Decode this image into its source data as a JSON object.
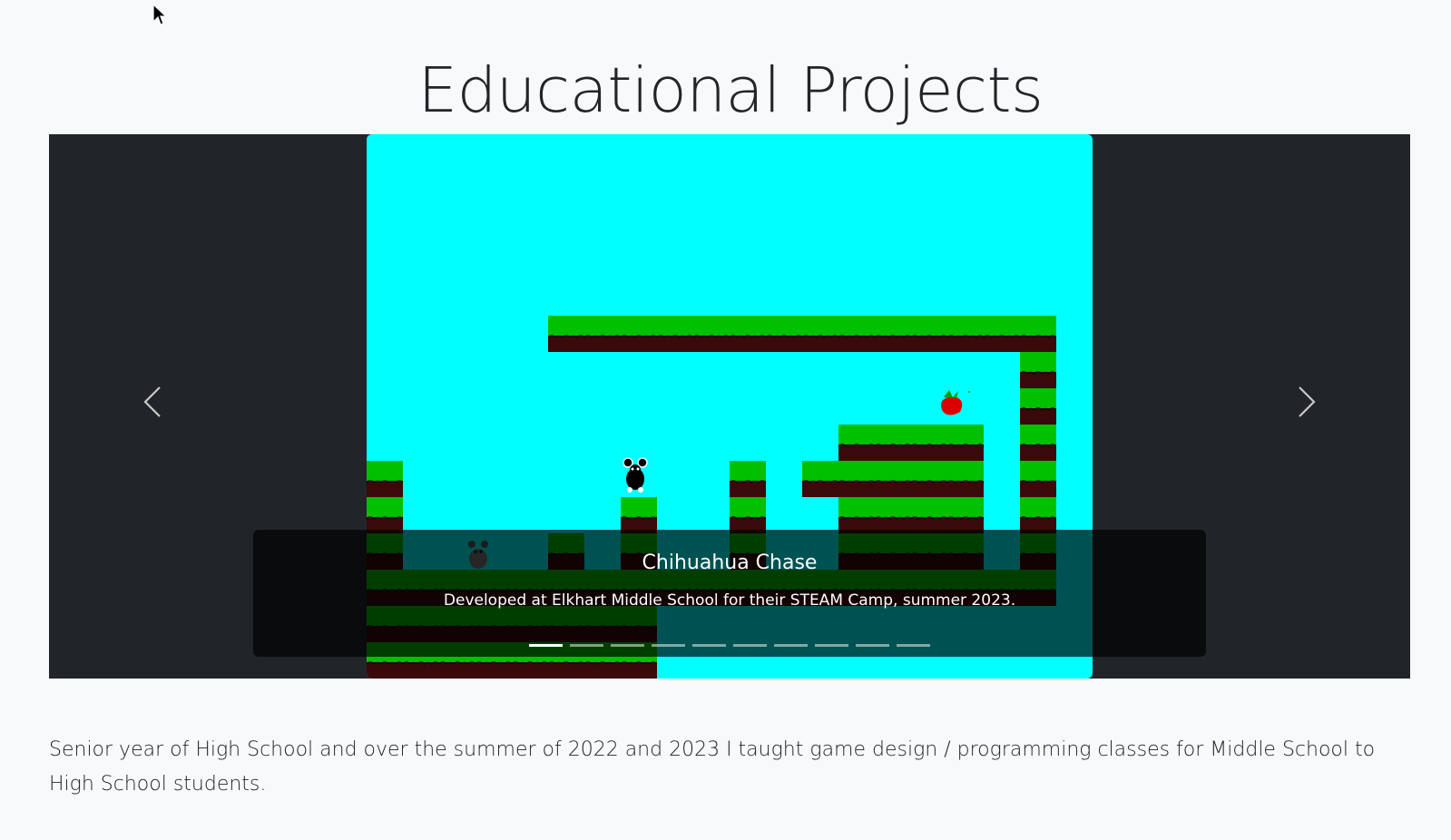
{
  "page": {
    "title": "Educational Projects",
    "description": "Senior year of High School and over the summer of 2022 and 2023 I taught game design / programming classes for Middle School to High School students."
  },
  "carousel": {
    "slide": {
      "title": "Chihuahua Chase",
      "caption": "Developed at Elkhart Middle School for their STEAM Camp, summer 2023.",
      "image_name": "chihuahua-chase-game-screenshot"
    },
    "indicator_count": 10,
    "active_index": 0,
    "prev_icon": "chevron-left-icon",
    "next_icon": "chevron-right-icon"
  },
  "colors": {
    "page_background": "#f8f9fa",
    "carousel_background": "#212529",
    "game_sky": "#00ffff",
    "grass": "#00c000",
    "dirt": "#3a0a0a"
  }
}
